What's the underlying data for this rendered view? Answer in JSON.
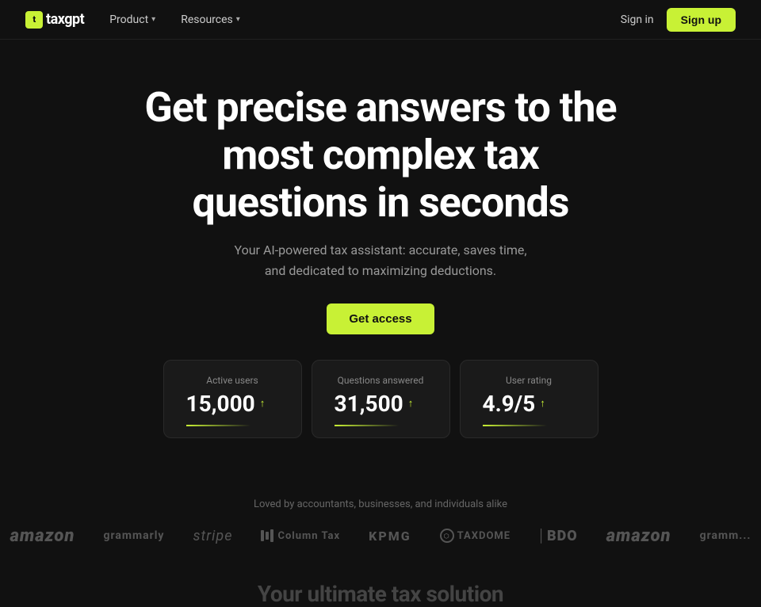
{
  "nav": {
    "logo_text": "taxgpt",
    "logo_icon": "t",
    "product_label": "Product",
    "resources_label": "Resources",
    "sign_in_label": "Sign in",
    "sign_up_label": "Sign up"
  },
  "hero": {
    "heading_line1": "Get precise answers to the",
    "heading_line2": "most complex tax",
    "heading_line3": "questions in seconds",
    "subtext": "Your AI-powered tax assistant: accurate, saves time, and dedicated to maximizing deductions.",
    "cta_label": "Get access"
  },
  "stats": [
    {
      "label": "Active users",
      "value": "15,000",
      "arrow": "↑"
    },
    {
      "label": "Questions answered",
      "value": "31,500",
      "arrow": "↑"
    },
    {
      "label": "User rating",
      "value": "4.9/5",
      "arrow": "↑"
    }
  ],
  "loved_by": {
    "text": "Loved by accountants, businesses, and individuals alike",
    "logos": [
      "amazon",
      "grammarly",
      "stripe",
      "Column Tax",
      "KPMG",
      "Taxdome",
      "BDO",
      "amazon",
      "grammarly"
    ]
  },
  "bottom_peek": {
    "text": "Your ultimate tax solution"
  }
}
